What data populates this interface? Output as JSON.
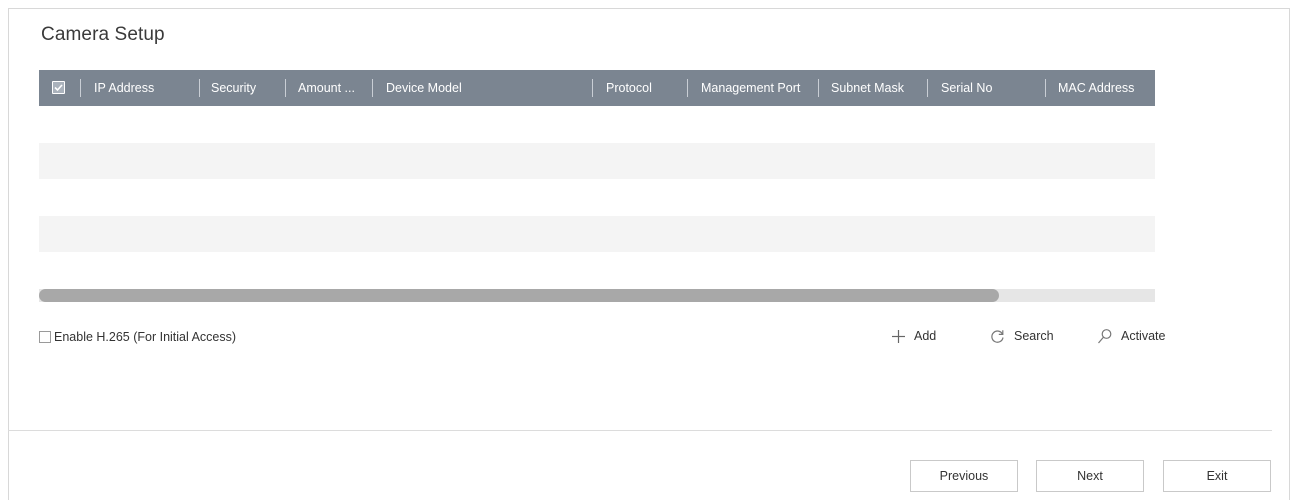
{
  "page": {
    "title": "Camera Setup"
  },
  "table": {
    "header_checkbox_checked": true,
    "columns": [
      "IP Address",
      "Security",
      "Amount ...",
      "Device Model",
      "Protocol",
      "Management Port",
      "Subnet Mask",
      "Serial No",
      "MAC Address"
    ],
    "rows": []
  },
  "scrollbar": {
    "thumb_fraction": 0.86
  },
  "options": {
    "h265_label": "Enable H.265 (For Initial Access)",
    "h265_checked": false
  },
  "actions": {
    "add": "Add",
    "search": "Search",
    "activate": "Activate"
  },
  "footer": {
    "previous": "Previous",
    "next": "Next",
    "exit": "Exit"
  },
  "colors": {
    "header_bg": "#7b8591",
    "alt_row": "#f4f4f4",
    "scroll_thumb": "#a8a8a8"
  }
}
